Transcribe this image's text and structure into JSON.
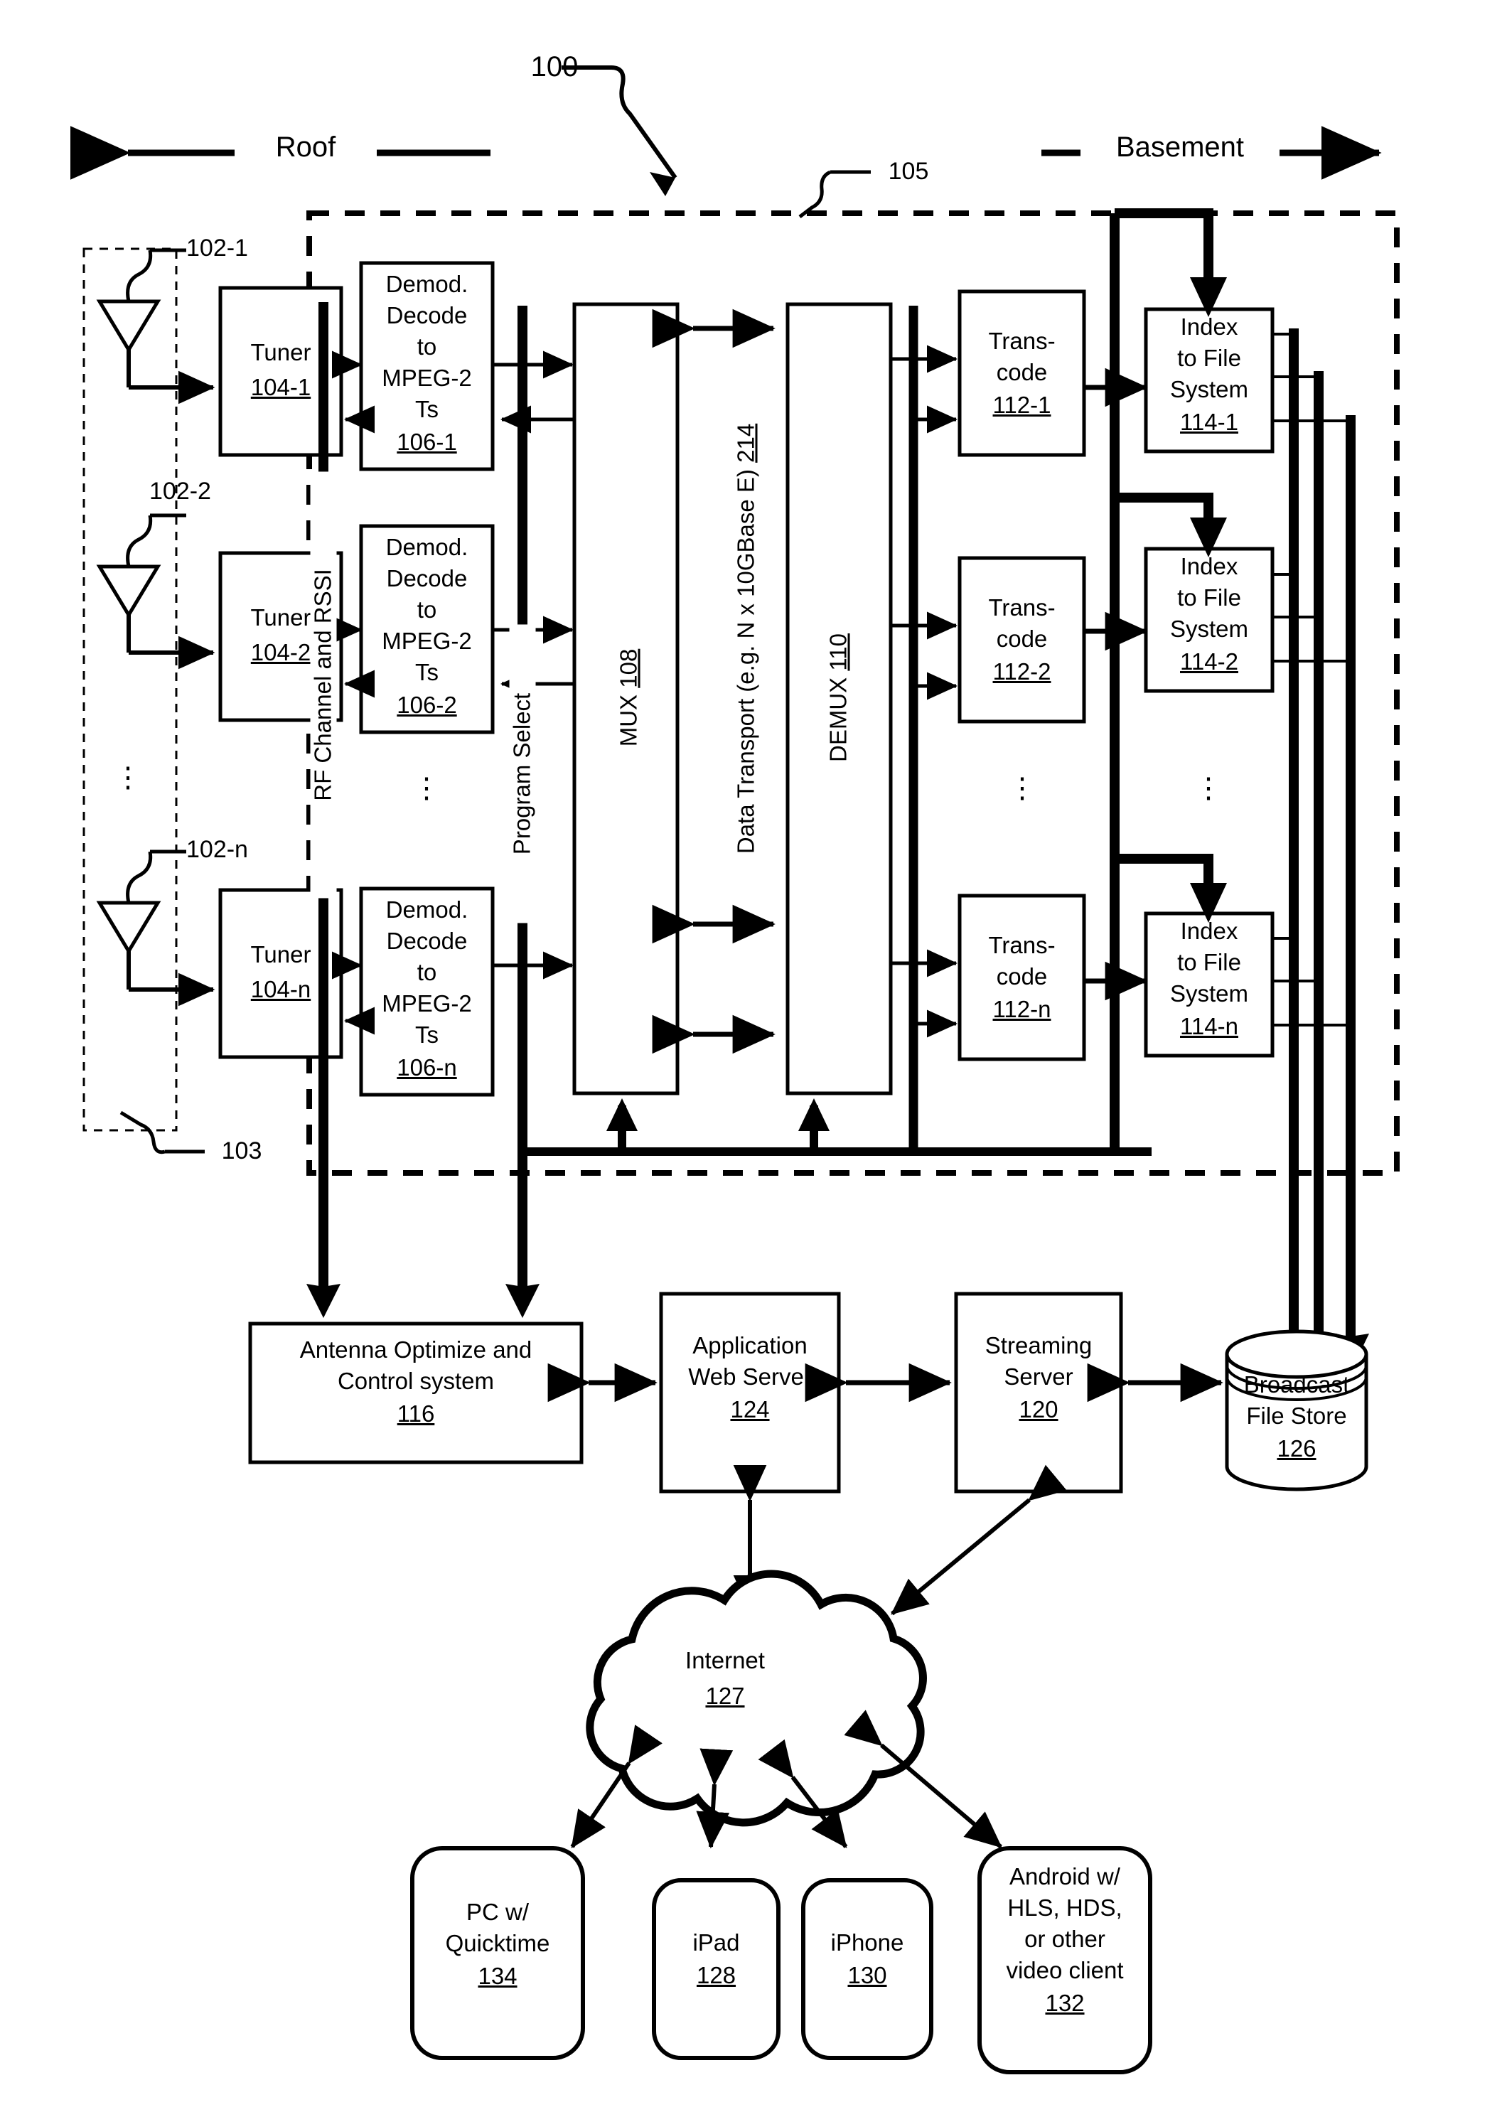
{
  "figure": {
    "number": "100",
    "system_boundary_ref": "105",
    "antenna_group_ref": "103",
    "zone_left": "Roof",
    "zone_right": "Basement"
  },
  "antennas": [
    {
      "ref": "102-1"
    },
    {
      "ref": "102-2"
    },
    {
      "ref": "102-n"
    }
  ],
  "tuners": [
    {
      "label": "Tuner",
      "ref": "104-1"
    },
    {
      "label": "Tuner",
      "ref": "104-2"
    },
    {
      "label": "Tuner",
      "ref": "104-n"
    }
  ],
  "demods": [
    {
      "l1": "Demod.",
      "l2": "Decode",
      "l3": "to",
      "l4": "MPEG-2",
      "l5": "Ts",
      "ref": "106-1"
    },
    {
      "l1": "Demod.",
      "l2": "Decode",
      "l3": "to",
      "l4": "MPEG-2",
      "l5": "Ts",
      "ref": "106-2"
    },
    {
      "l1": "Demod.",
      "l2": "Decode",
      "l3": "to",
      "l4": "MPEG-2",
      "l5": "Ts",
      "ref": "106-n"
    }
  ],
  "bus_labels": {
    "rf_channel": "RF Channel and RSSI",
    "program_select": "Program Select",
    "data_transport": "Data Transport (e.g. N x 10GBase E) 214",
    "data_transport_text": "Data Transport (e.g. N x 10GBase E)",
    "data_transport_ref": "214"
  },
  "mux": {
    "label": "MUX",
    "ref": "108"
  },
  "demux": {
    "label": "DEMUX",
    "ref": "110"
  },
  "transcoders": [
    {
      "l1": "Trans-",
      "l2": "code",
      "ref": "112-1"
    },
    {
      "l1": "Trans-",
      "l2": "code",
      "ref": "112-2"
    },
    {
      "l1": "Trans-",
      "l2": "code",
      "ref": "112-n"
    }
  ],
  "indexers": [
    {
      "l1": "Index",
      "l2": "to File",
      "l3": "System",
      "ref": "114-1"
    },
    {
      "l1": "Index",
      "l2": "to File",
      "l3": "System",
      "ref": "114-2"
    },
    {
      "l1": "Index",
      "l2": "to File",
      "l3": "System",
      "ref": "114-n"
    }
  ],
  "servers": {
    "antenna_control": {
      "l1": "Antenna Optimize and",
      "l2": "Control system",
      "ref": "116"
    },
    "app_web": {
      "l1": "Application",
      "l2": "Web Server",
      "ref": "124"
    },
    "streaming": {
      "l1": "Streaming",
      "l2": "Server",
      "ref": "120"
    },
    "file_store": {
      "l1": "Broadcast",
      "l2": "File Store",
      "ref": "126"
    }
  },
  "internet": {
    "label": "Internet",
    "ref": "127"
  },
  "clients": [
    {
      "lines": [
        "PC w/",
        "Quicktime"
      ],
      "ref": "134"
    },
    {
      "lines": [
        "iPad"
      ],
      "ref": "128"
    },
    {
      "lines": [
        "iPhone"
      ],
      "ref": "130"
    },
    {
      "lines": [
        "Android w/",
        "HLS, HDS,",
        "or other",
        "video client"
      ],
      "ref": "132"
    }
  ],
  "ellipsis": "⋮",
  "colors": {
    "ink": "#000000",
    "paper": "#ffffff"
  }
}
